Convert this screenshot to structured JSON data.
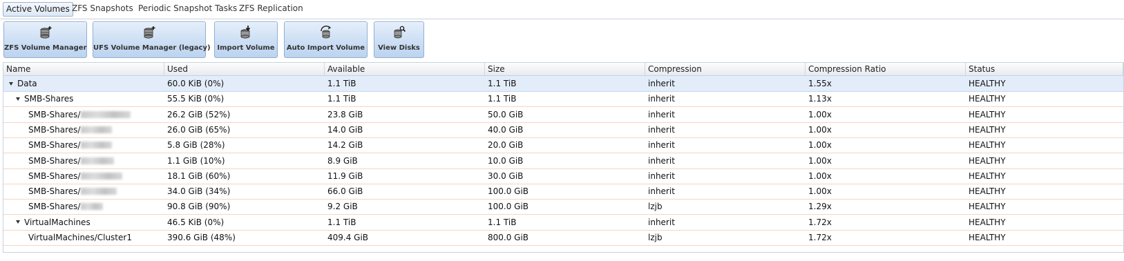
{
  "tabs": [
    {
      "label": "Active Volumes",
      "active": true
    },
    {
      "label": "ZFS Snapshots",
      "active": false
    },
    {
      "label": "Periodic Snapshot Tasks",
      "active": false
    },
    {
      "label": "ZFS Replication",
      "active": false
    }
  ],
  "toolbar": [
    {
      "label": "ZFS Volume Manager",
      "icon": "volume-add-icon"
    },
    {
      "label": "UFS Volume Manager (legacy)",
      "icon": "volume-add-icon"
    },
    {
      "label": "Import Volume",
      "icon": "import-icon"
    },
    {
      "label": "Auto Import Volume",
      "icon": "auto-import-icon"
    },
    {
      "label": "View Disks",
      "icon": "view-disks-icon"
    }
  ],
  "columns": [
    "Name",
    "Used",
    "Available",
    "Size",
    "Compression",
    "Compression Ratio",
    "Status"
  ],
  "rows": [
    {
      "name": "Data",
      "used": "60.0 KiB (0%)",
      "available": "1.1 TiB",
      "size": "1.1 TiB",
      "compression": "inherit",
      "ratio": "1.55x",
      "status": "HEALTHY"
    },
    {
      "name": "SMB-Shares",
      "used": "55.5 KiB (0%)",
      "available": "1.1 TiB",
      "size": "1.1 TiB",
      "compression": "inherit",
      "ratio": "1.13x",
      "status": "HEALTHY"
    },
    {
      "name": "SMB-Shares/",
      "used": "26.2 GiB (52%)",
      "available": "23.8 GiB",
      "size": "50.0 GiB",
      "compression": "inherit",
      "ratio": "1.00x",
      "status": "HEALTHY"
    },
    {
      "name": "SMB-Shares/",
      "used": "26.0 GiB (65%)",
      "available": "14.0 GiB",
      "size": "40.0 GiB",
      "compression": "inherit",
      "ratio": "1.00x",
      "status": "HEALTHY"
    },
    {
      "name": "SMB-Shares/",
      "used": "5.8 GiB (28%)",
      "available": "14.2 GiB",
      "size": "20.0 GiB",
      "compression": "inherit",
      "ratio": "1.00x",
      "status": "HEALTHY"
    },
    {
      "name": "SMB-Shares/",
      "used": "1.1 GiB (10%)",
      "available": "8.9 GiB",
      "size": "10.0 GiB",
      "compression": "inherit",
      "ratio": "1.00x",
      "status": "HEALTHY"
    },
    {
      "name": "SMB-Shares/",
      "used": "18.1 GiB (60%)",
      "available": "11.9 GiB",
      "size": "30.0 GiB",
      "compression": "inherit",
      "ratio": "1.00x",
      "status": "HEALTHY"
    },
    {
      "name": "SMB-Shares/",
      "used": "34.0 GiB (34%)",
      "available": "66.0 GiB",
      "size": "100.0 GiB",
      "compression": "inherit",
      "ratio": "1.00x",
      "status": "HEALTHY"
    },
    {
      "name": "SMB-Shares/",
      "used": "90.8 GiB (90%)",
      "available": "9.2 GiB",
      "size": "100.0 GiB",
      "compression": "lzjb",
      "ratio": "1.29x",
      "status": "HEALTHY"
    },
    {
      "name": "VirtualMachines",
      "used": "46.5 KiB (0%)",
      "available": "1.1 TiB",
      "size": "1.1 TiB",
      "compression": "inherit",
      "ratio": "1.72x",
      "status": "HEALTHY"
    },
    {
      "name": "VirtualMachines/Cluster1",
      "used": "390.6 GiB (48%)",
      "available": "409.4 GiB",
      "size": "800.0 GiB",
      "compression": "lzjb",
      "ratio": "1.72x",
      "status": "HEALTHY"
    }
  ]
}
